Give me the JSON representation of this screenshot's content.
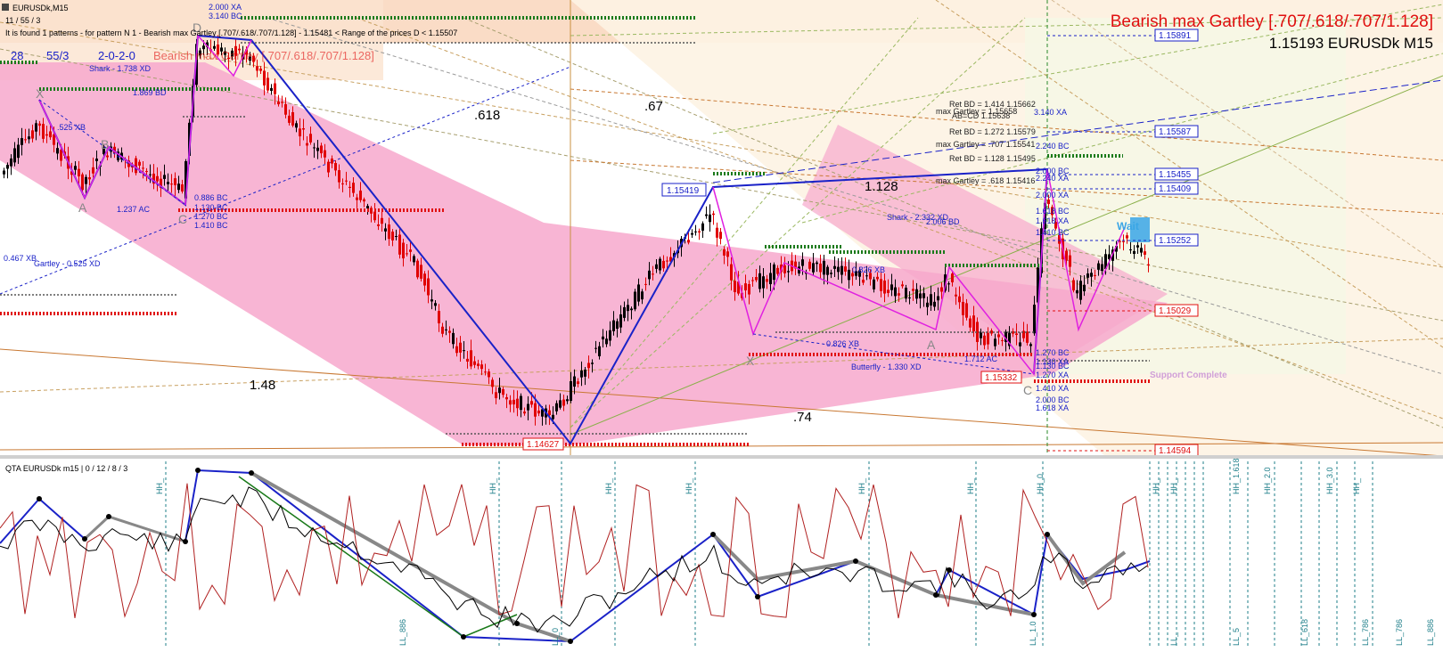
{
  "window": {
    "symbol_tab": "EURUSDk,M15",
    "info_line_1": "11 / 55 / 3",
    "info_line_2": "It is found 1 patterns  -  for pattern N 1 - Bearish max Gartley [.707/.618/.707/1.128]  - 1.15481 < Range of the prices D < 1.15507",
    "counter_row": [
      "28",
      "55/3",
      "2-0-2-0"
    ],
    "pattern_title": "Bearish max Gartley [.707/.618/.707/1.128]",
    "price_symbol": "1.15193 EURUSDk M15"
  },
  "colors": {
    "bull_candle": "#000000",
    "bear_candle": "#e00000",
    "pattern_blue": "#1a22c8",
    "pattern_magenta": "#e020e0",
    "zone_pink": "#f7a8cc",
    "support_green": "#1a7a1a",
    "resistance_red": "#e01010",
    "channel_brown": "#c87832"
  },
  "price_labels": [
    "1.15891",
    "1.15587",
    "1.15455",
    "1.15409",
    "1.15252",
    "1.15029",
    "1.14594"
  ],
  "boxed_prices": {
    "x_peak": "1.15419",
    "low_main": "1.14627",
    "low_c": "1.15332"
  },
  "ratios": {
    "r618": ".618",
    "r67": ".67",
    "r1128": "1.128",
    "r148": "1.48",
    "r74": ".74"
  },
  "points": {
    "x1": "X",
    "a1": "A",
    "b1": "B",
    "c1": "C",
    "d1": "D",
    "x2": "X",
    "a2": "A",
    "c2": "C"
  },
  "annotations": {
    "xb_525": ".525 XB",
    "ac_1237": "1.237 AC",
    "bc_886": "0.886 BC",
    "bc_1130": "1.130 BC",
    "bc_1270": "1.270 BC",
    "bc_1410": "1.410 BC",
    "xb_467": "0.467 XB",
    "gartley_525": "Gartley - 0.525 XD",
    "shark_1738": "Shark - 1.738 XD",
    "bd_1869": "1.869 BD",
    "xa_2000": "2.000 XA",
    "bc_3140": "3.140 BC",
    "shark_2332": "Shark - 2.332 XD",
    "bd_2006": "2.006 BD",
    "xb_826": "0.826 XB",
    "butterfly": "Butterfly - 1.330 XD",
    "ac_1712": "1.712 AC",
    "xb_mid": "0.826 XB",
    "retbd_1414": "Ret BD = 1.414  1.15662",
    "maxgartley_top": "max Gartley = 1.15658",
    "abcd": "AB=CD  1.15638",
    "xa_3140": "3.140 XA",
    "retbd_1272": "Ret BD = 1.272  1.15579",
    "maxgartley_707": "max Gartley = .707  1.15541",
    "retbd_1128": "Ret BD = 1.128  1.15495",
    "maxgartley_618": "max Gartley = .618  1.15416",
    "bc_2240": "2.240 BC",
    "bc_2000": "2.000 BC",
    "xa_2240": "2.240 XA",
    "xa_2000b": "2.000 XA",
    "bc_1618": "1.618 BC",
    "xa_1618": "1.618 XA",
    "bc_1410b": "1.410 BC",
    "wait": "Wait",
    "bc_1270b": "1.270 BC",
    "xa_1130": "1.130 XA",
    "bc_1130b": "1.130 BC",
    "xa_1270": "1.270 XA",
    "xa_1410": "1.410 XA",
    "bc_2000b": "2.000 BC",
    "xa_1618b": "1.618 XA",
    "support_complete": "Support Complete"
  },
  "indicator": {
    "title": "QTA EURUSDk m15 | 0 / 12 / 8 / 3",
    "hh_labels": [
      "HH_",
      "HH_",
      "HH_",
      "HH_",
      "HH_",
      "HH_",
      "HH_0",
      "HH_",
      "HH_",
      "HH_1.618",
      "HH_2.0",
      "HH_3.0",
      "HH_"
    ],
    "ll_labels": [
      "LL_886",
      "LL_0",
      "LL_1.0",
      "LL_",
      "LL_5",
      "LL_618",
      "LL_786",
      "LL_786",
      "LL_886"
    ]
  }
}
